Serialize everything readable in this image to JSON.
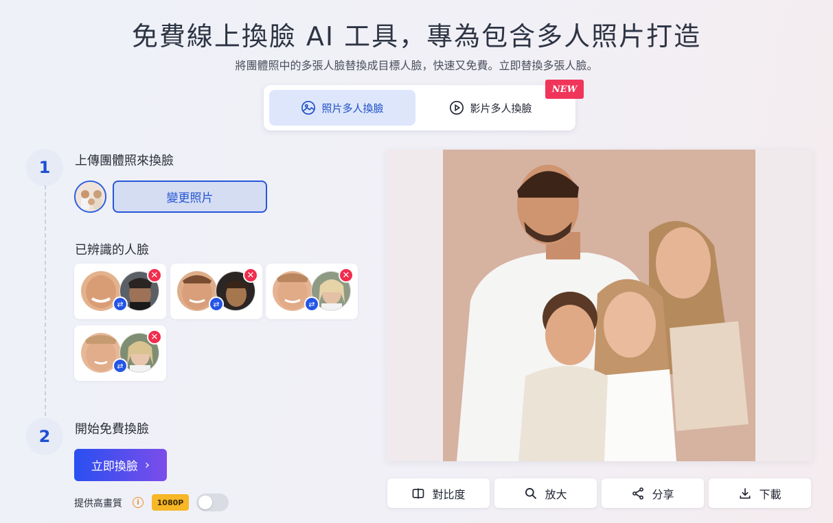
{
  "header": {
    "title": "免費線上換臉 AI 工具，專為包含多人照片打造",
    "subtitle": "將團體照中的多張人臉替換成目標人臉，快速又免費。立即替換多張人臉。"
  },
  "tabs": {
    "photo_label": "照片多人換臉",
    "video_label": "影片多人換臉",
    "new_badge": "NEW"
  },
  "step1": {
    "number": "1",
    "label": "上傳團體照來換臉",
    "change_button": "變更照片",
    "faces_heading": "已辨識的人臉"
  },
  "step2": {
    "number": "2",
    "label": "開始免費換臉",
    "start_button": "立即換臉"
  },
  "quality": {
    "label": "提供高畫質",
    "badge": "1080P",
    "toggle_on": false
  },
  "actions": {
    "compare": "對比度",
    "zoom": "放大",
    "share": "分享",
    "download": "下載"
  },
  "colors": {
    "accent": "#2455e6",
    "delete": "#f12d4e",
    "badge": "#f7b726",
    "new": "#f0355a"
  }
}
